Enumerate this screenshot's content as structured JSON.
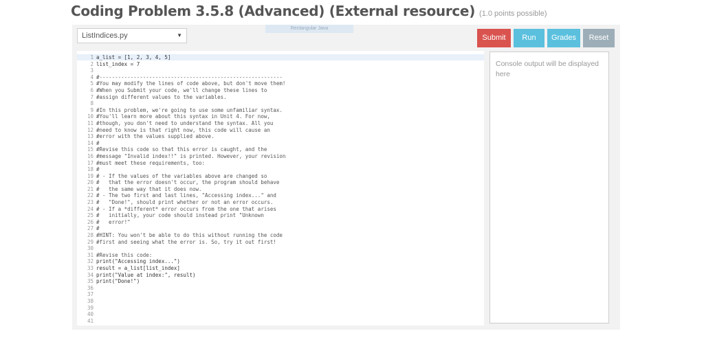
{
  "header": {
    "title": "Coding Problem 3.5.8 (Advanced) (External resource)",
    "points": "(1.0 points possible)"
  },
  "toolbar": {
    "file_select": "ListIndices.py",
    "faded_tab": "Rectangular Java",
    "submit_label": "Submit",
    "run_label": "Run",
    "grades_label": "Grades",
    "reset_label": "Reset"
  },
  "colors": {
    "submit": "#d9534f",
    "run": "#5bc0de",
    "grades": "#5bc0de",
    "reset": "#9daeb8"
  },
  "console": {
    "placeholder": "Console output will be displayed here"
  },
  "editor": {
    "lines": [
      "a_list = [1, 2, 3, 4, 5]",
      "list_index = 7",
      "",
      "#-----------------------------------------------------------",
      "#You may modify the lines of code above, but don't move them!",
      "#When you Submit your code, we'll change these lines to",
      "#assign different values to the variables.",
      "",
      "#In this problem, we're going to use some unfamiliar syntax.",
      "#You'll learn more about this syntax in Unit 4. For now,",
      "#though, you don't need to understand the syntax. All you",
      "#need to know is that right now, this code will cause an",
      "#error with the values supplied above.",
      "#",
      "#Revise this code so that this error is caught, and the",
      "#message \"Invalid index!!\" is printed. However, your revision",
      "#must meet these requirements, too:",
      "#",
      "# - If the values of the variables above are changed so",
      "#   that the error doesn't occur, the program should behave",
      "#   the same way that it does now.",
      "# - The two first and last lines, \"Accessing index...\" and",
      "#   \"Done!\", should print whether or not an error occurs.",
      "# - If a *different* error occurs from the one that arises",
      "#   initially, your code should instead print \"Unknown",
      "#   error!\"",
      "#",
      "#HINT: You won't be able to do this without running the code",
      "#first and seeing what the error is. So, try it out first!",
      "",
      "#Revise this code:",
      "print(\"Accessing index...\")",
      "result = a_list[list_index]",
      "print(\"Value at index:\", result)",
      "print(\"Done!\")",
      "",
      "",
      "",
      "",
      "",
      ""
    ]
  }
}
